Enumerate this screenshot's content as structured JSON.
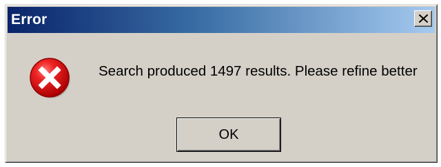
{
  "dialog": {
    "title": "Error",
    "message": "Search produced 1497 results. Please refine better",
    "ok_label": "OK",
    "icon": "error-icon",
    "close_icon": "close-icon"
  },
  "colors": {
    "titlebar_start": "#0a246a",
    "titlebar_end": "#a6caf0",
    "window_face": "#d4d0c8",
    "error_red": "#cc1111"
  }
}
